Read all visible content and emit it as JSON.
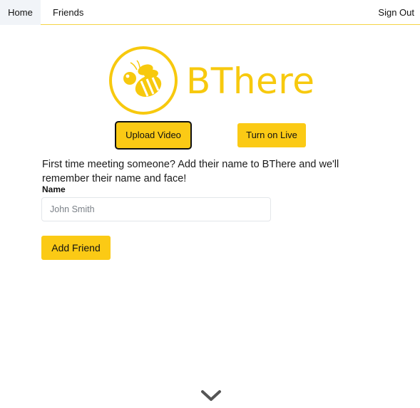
{
  "nav": {
    "home": "Home",
    "friends": "Friends",
    "sign_out": "Sign Out"
  },
  "brand": {
    "name": "BThere",
    "logo_icon": "bee-icon",
    "color": "#f7c90e"
  },
  "actions": {
    "upload_video": "Upload Video",
    "turn_on_live": "Turn on Live"
  },
  "form": {
    "intro": "First time meeting someone? Add their name to BThere and we'll remember their name and face!",
    "name_label": "Name",
    "name_placeholder": "John Smith",
    "name_value": "",
    "submit": "Add Friend"
  },
  "footer": {
    "scroll_icon": "chevron-down-icon"
  },
  "colors": {
    "accent": "#fbca15",
    "nav_border": "#f5d547",
    "active_tab_bg": "#f1f4f8"
  }
}
